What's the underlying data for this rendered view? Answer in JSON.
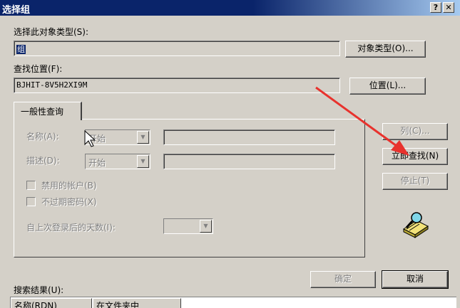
{
  "window": {
    "title": "选择组",
    "help_button": "?",
    "close_button": "✕"
  },
  "object_type": {
    "label": "选择此对象类型(S):",
    "value": "组",
    "button_label": "对象类型(O)..."
  },
  "location": {
    "label": "查找位置(F):",
    "value": "BJHIT-8V5H2XI9M",
    "button_label": "位置(L)..."
  },
  "tab": {
    "label": "一般性查询"
  },
  "query": {
    "name_label": "名称(A):",
    "name_operator": "开始",
    "description_label": "描述(D):",
    "description_operator": "开始",
    "disabled_accounts_label": "禁用的帐户(B)",
    "non_expiring_password_label": "不过期密码(X)",
    "days_since_logon_label": "自上次登录后的天数(I):"
  },
  "buttons": {
    "columns": "列(C)...",
    "find_now": "立即查找(N)",
    "stop": "停止(T)",
    "ok": "确定",
    "cancel": "取消"
  },
  "results": {
    "label": "搜索结果(U):",
    "columns": [
      "名称(RDN)",
      "在文件夹中"
    ]
  },
  "colors": {
    "titlebar": "#0a246a",
    "dialog_bg": "#d4d0c8",
    "annotation_arrow": "#e8322d"
  }
}
